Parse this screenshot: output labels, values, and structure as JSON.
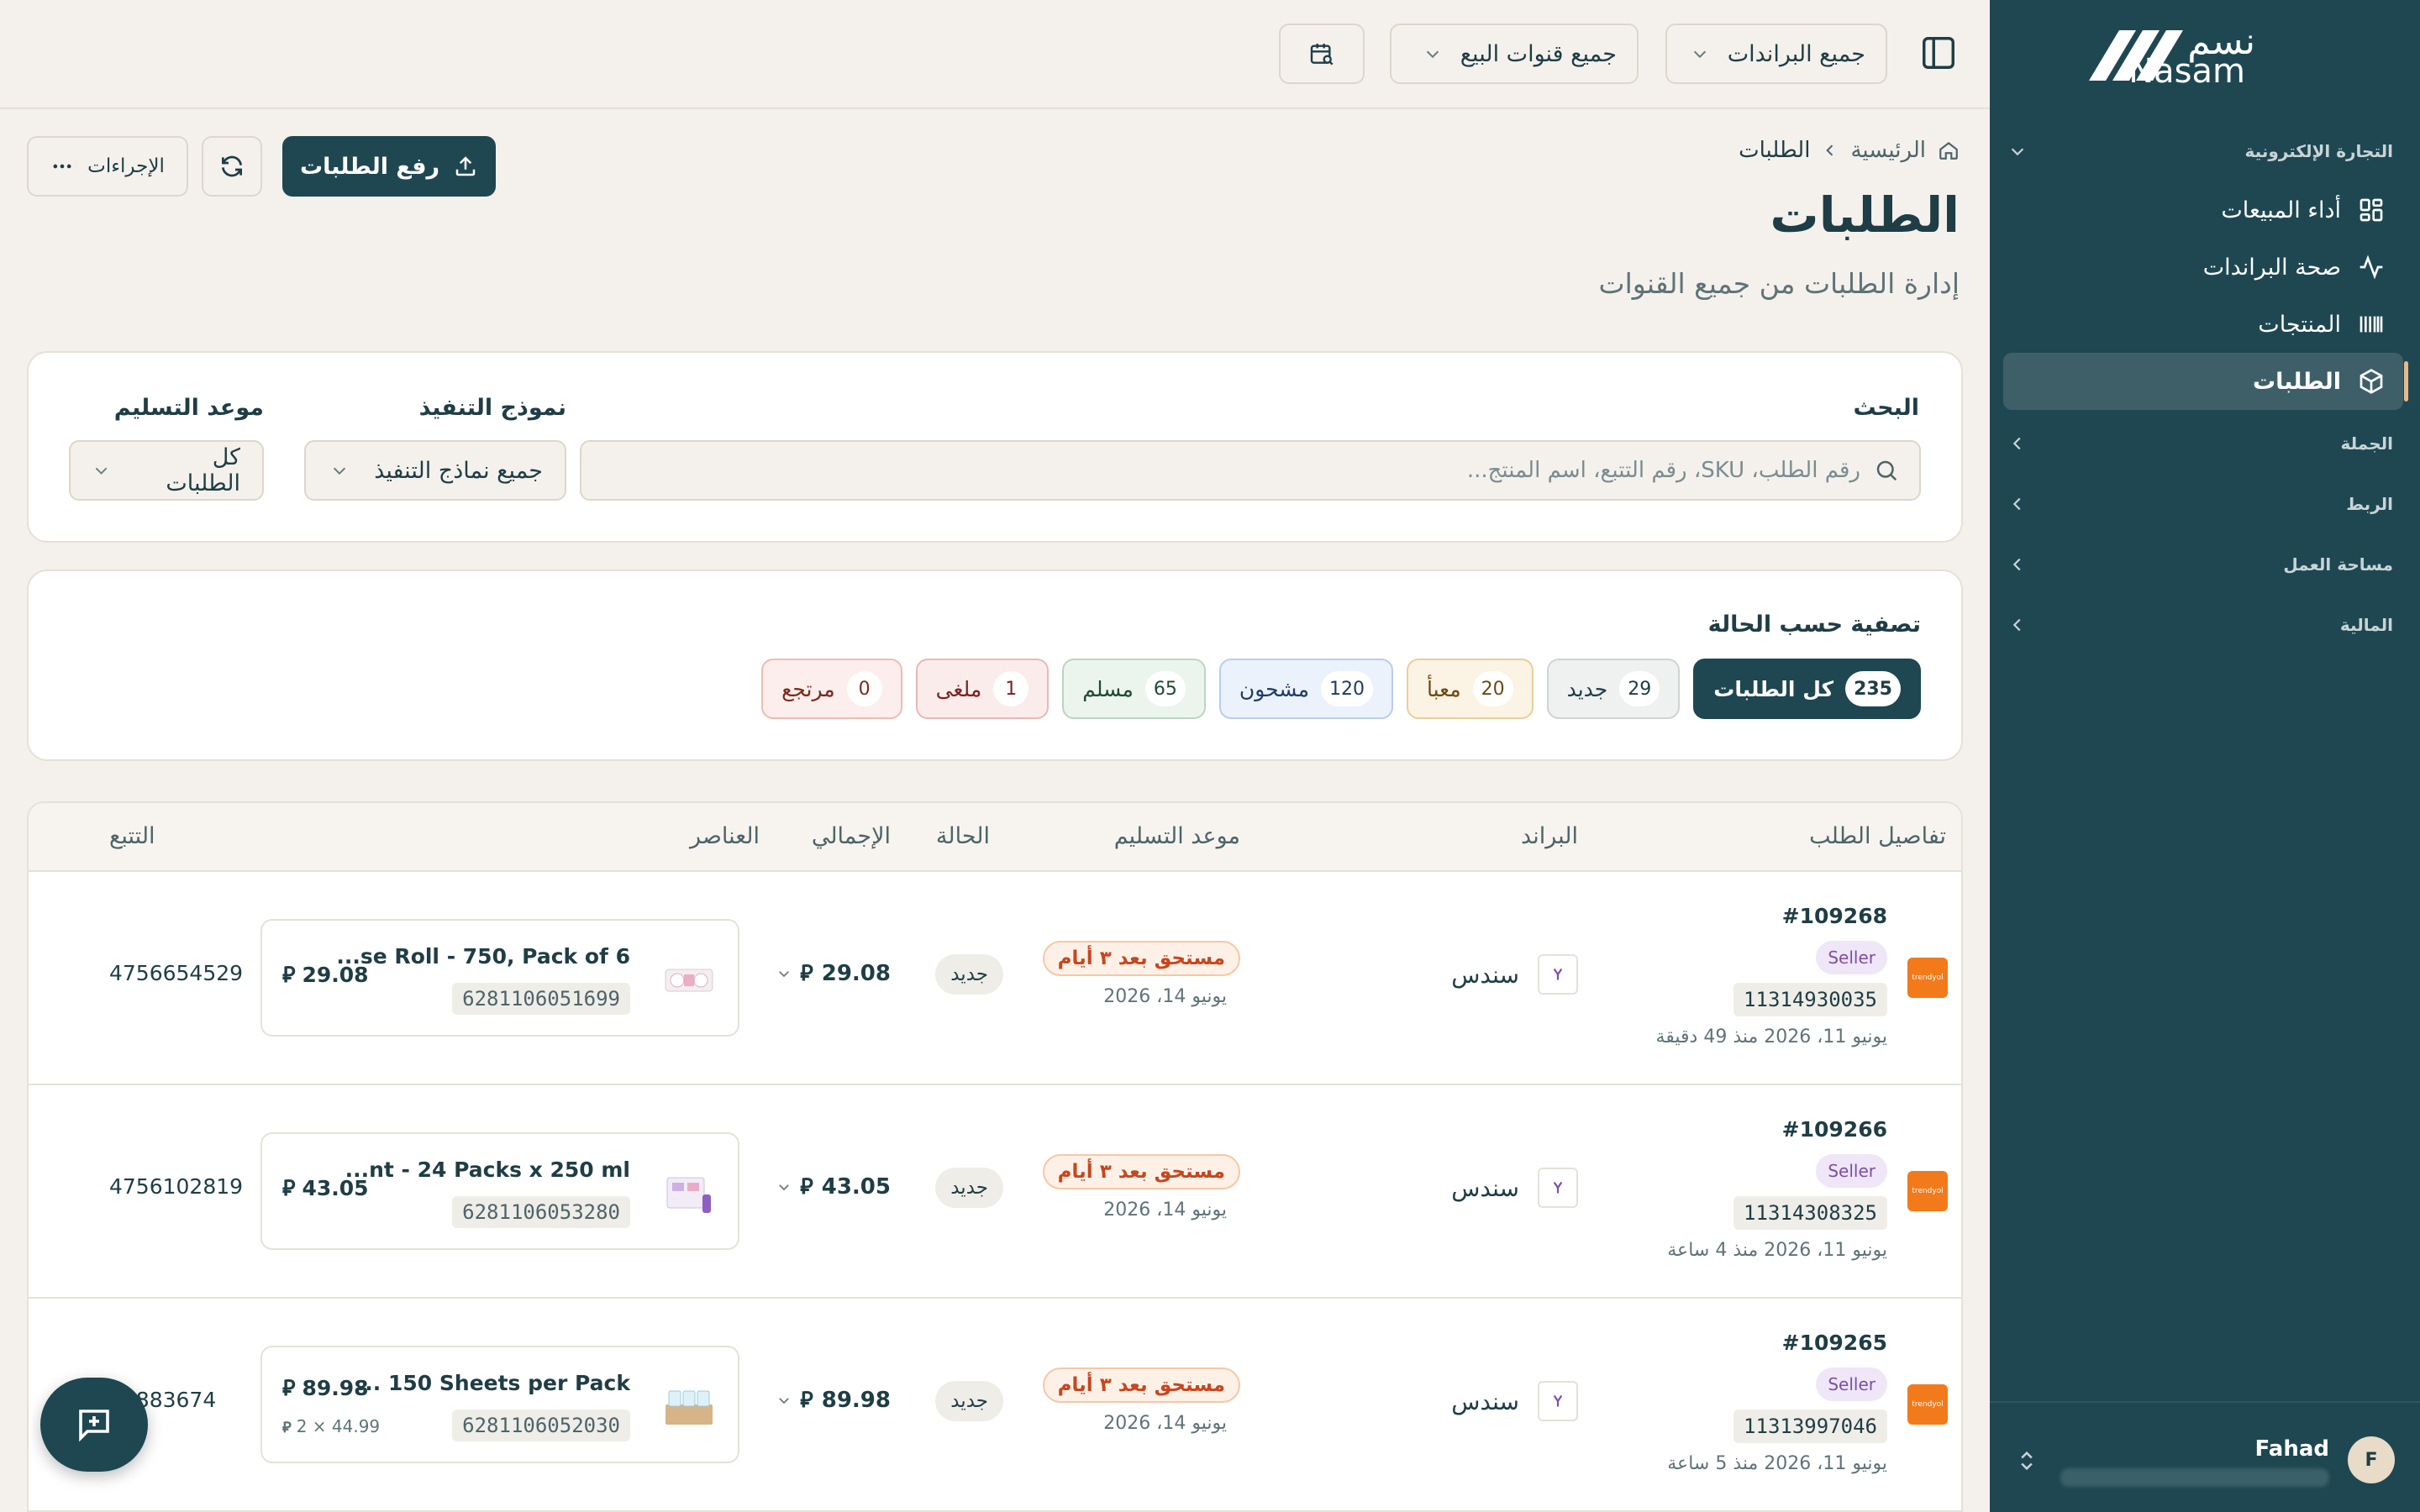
{
  "brand": {
    "name_ar": "نسم",
    "name_en": "Nasam"
  },
  "sidebar": {
    "sections": [
      {
        "label": "التجارة الإلكترونية",
        "expanded": true
      },
      {
        "label": "الجملة",
        "expanded": false
      },
      {
        "label": "الربط",
        "expanded": false
      },
      {
        "label": "مساحة العمل",
        "expanded": false
      },
      {
        "label": "المالية",
        "expanded": false
      }
    ],
    "items": [
      {
        "label": "أداء المبيعات",
        "icon": "dashboard-icon"
      },
      {
        "label": "صحة البراندات",
        "icon": "activity-icon"
      },
      {
        "label": "المنتجات",
        "icon": "barcode-icon"
      },
      {
        "label": "الطلبات",
        "icon": "package-icon",
        "active": true
      }
    ],
    "user": {
      "name": "Fahad",
      "initial": "F"
    }
  },
  "topbar": {
    "brands_filter": "جميع البراندات",
    "channels_filter": "جميع قنوات البيع"
  },
  "header": {
    "breadcrumb_home": "الرئيسية",
    "breadcrumb_current": "الطلبات",
    "title": "الطلبات",
    "subtitle": "إدارة الطلبات من جميع القنوات",
    "upload_button": "رفع الطلبات",
    "actions_button": "الإجراءات"
  },
  "filters": {
    "search_label": "البحث",
    "search_placeholder": "رقم الطلب، SKU، رقم التتبع، اسم المنتج...",
    "fulfillment_label": "نموذج التنفيذ",
    "fulfillment_value": "جميع نماذج التنفيذ",
    "delivery_label": "موعد التسليم",
    "delivery_value": "كل الطلبات"
  },
  "status_filter": {
    "title": "تصفية حسب الحالة",
    "chips": [
      {
        "label": "كل الطلبات",
        "count": "235"
      },
      {
        "label": "جديد",
        "count": "29"
      },
      {
        "label": "معبأ",
        "count": "20"
      },
      {
        "label": "مشحون",
        "count": "120"
      },
      {
        "label": "مسلم",
        "count": "65"
      },
      {
        "label": "ملغى",
        "count": "1"
      },
      {
        "label": "مرتجع",
        "count": "0"
      }
    ]
  },
  "table": {
    "columns": [
      "تفاصيل الطلب",
      "البراند",
      "موعد التسليم",
      "الحالة",
      "الإجمالي",
      "العناصر",
      "التتبع"
    ],
    "rows": [
      {
        "store": "trendyol",
        "order_id": "#109268",
        "seller_badge": "Seller",
        "order_number": "11314930035",
        "order_date": "يونيو 11، 2026   منذ 49 دقيقة",
        "brand": "سندس",
        "due": "مستحق بعد ٣ أيام",
        "due_date": "يونيو 14، 2026",
        "status": "جديد",
        "total": "29.08",
        "item_name": "...se Roll - 750, Pack of 6",
        "item_sku": "6281106051699",
        "item_price": "29.08",
        "item_unit": "",
        "tracking": "4756654529"
      },
      {
        "store": "trendyol",
        "order_id": "#109266",
        "seller_badge": "Seller",
        "order_number": "11314308325",
        "order_date": "يونيو 11، 2026   منذ 4 ساعة",
        "brand": "سندس",
        "due": "مستحق بعد ٣ أيام",
        "due_date": "يونيو 14، 2026",
        "status": "جديد",
        "total": "43.05",
        "item_name": "...nt - 24 Packs x 250 ml",
        "item_sku": "6281106053280",
        "item_price": "43.05",
        "item_unit": "",
        "tracking": "4756102819"
      },
      {
        "store": "trendyol",
        "order_id": "#109265",
        "seller_badge": "Seller",
        "order_number": "11313997046",
        "order_date": "يونيو 11، 2026   منذ 5 ساعة",
        "brand": "سندس",
        "due": "مستحق بعد ٣ أيام",
        "due_date": "يونيو 14، 2026",
        "status": "جديد",
        "total": "89.98",
        "item_name": "... 150 Sheets per Pack",
        "item_sku": "6281106052030",
        "item_price": "89.98",
        "item_unit": "2 × 44.99",
        "tracking": "55883674"
      }
    ]
  },
  "colors": {
    "primary": "#1e4752",
    "background": "#f4f1ec",
    "accent": "#e7b98b",
    "due_warning": "#c8461e"
  }
}
